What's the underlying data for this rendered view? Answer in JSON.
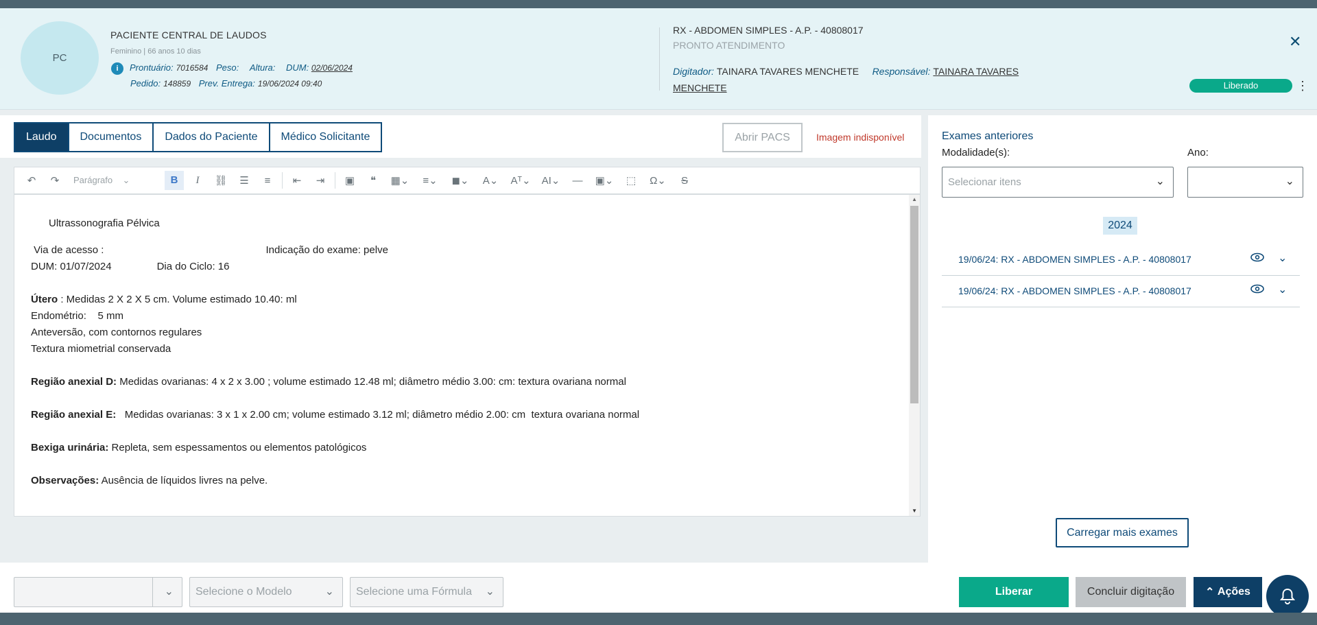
{
  "patient": {
    "initials": "PC",
    "name": "PACIENTE CENTRAL DE LAUDOS",
    "subtitle": "Feminino | 66 anos 10 dias",
    "info_icon": "info-icon",
    "prontuario_label": "Prontuário:",
    "prontuario": "7016584",
    "peso_label": "Peso:",
    "altura_label": "Altura:",
    "dum_label": "DUM:",
    "dum": "02/06/2024",
    "pedido_label": "Pedido:",
    "pedido": "148859",
    "prev_label": "Prev. Entrega:",
    "prev": "19/06/2024 09:40"
  },
  "exam": {
    "title": "RX - ABDOMEN SIMPLES - A.P. - 40808017",
    "sector": "PRONTO ATENDIMENTO",
    "digitador_label": "Digitador:",
    "digitador": "TAINARA TAVARES MENCHETE",
    "responsavel_label": "Responsável:",
    "responsavel": "TAINARA TAVARES MENCHETE",
    "status": "Liberado",
    "status_color": "#0aa98a"
  },
  "tabs": [
    "Laudo",
    "Documentos",
    "Dados do Paciente",
    "Médico Solicitante"
  ],
  "abrir_pacs": "Abrir PACS",
  "imagem_indisponivel": "Imagem indisponível",
  "toolbar": {
    "paragraph": "Parágrafo"
  },
  "report": {
    "title": "Ultrassonografia Pélvica",
    "via": " Via de acesso :",
    "indicacao": "Indicação do exame: pelve",
    "dum": "DUM: 01/07/2024",
    "ciclo": "Dia do Ciclo: 16",
    "utero_label": "Útero",
    "utero": " : Medidas 2 X 2 X 5 cm. Volume estimado 10.40: ml",
    "endometrio": "Endométrio:    5 mm",
    "anteversao": "Anteversão, com contornos regulares",
    "textura": "Textura miometrial conservada",
    "anexial_d_label": "Região anexial D:",
    "anexial_d": " Medidas ovarianas: 4 x 2 x 3.00 ; volume estimado 12.48 ml; diâmetro médio 3.00: cm: textura ovariana normal",
    "anexial_e_label": "Região anexial E:",
    "anexial_e": "   Medidas ovarianas: 3 x 1 x 2.00 cm; volume estimado 3.12 ml; diâmetro médio 2.00: cm  textura ovariana normal",
    "bexiga_label": "Bexiga urinária:",
    "bexiga": " Repleta, sem espessamentos ou elementos patológicos",
    "obs_label": "Observações:",
    "obs": " Ausência de líquidos livres na pelve."
  },
  "previous": {
    "title": "Exames anteriores",
    "modalidade_label": "Modalidade(s):",
    "modalidade_placeholder": "Selecionar itens",
    "ano_label": "Ano:",
    "year": "2024",
    "items": [
      "19/06/24: RX - ABDOMEN SIMPLES - A.P. - 40808017",
      "19/06/24: RX - ABDOMEN SIMPLES - A.P. - 40808017"
    ],
    "load_more": "Carregar mais exames"
  },
  "bottom": {
    "modelo_placeholder": "Selecione o Modelo",
    "formula_placeholder": "Selecione uma Fórmula",
    "liberar": "Liberar",
    "concluir": "Concluir digitação",
    "acoes": "Ações"
  }
}
